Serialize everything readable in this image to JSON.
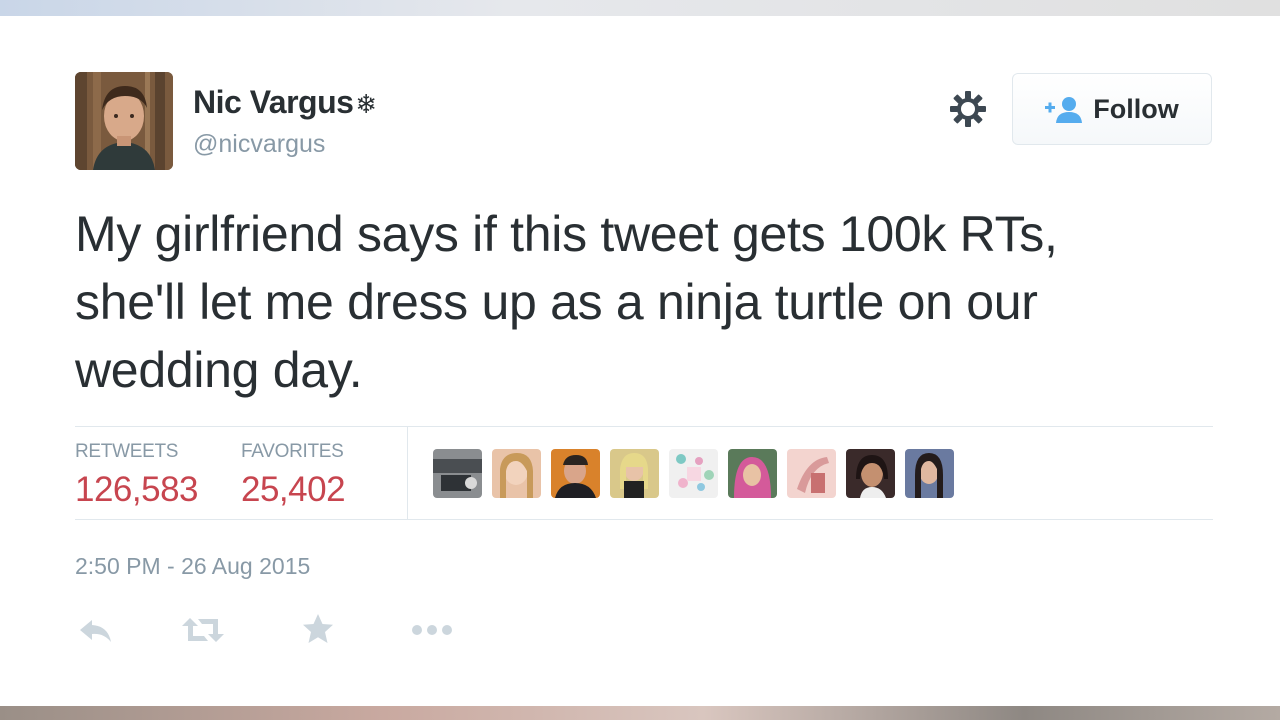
{
  "author": {
    "name": "Nic Vargus",
    "badge": "❄",
    "handle": "@nicvargus",
    "avatar_icon": "profile-photo"
  },
  "header": {
    "settings_icon": "gear-icon",
    "follow_icon": "add-user-icon",
    "follow_label": "Follow"
  },
  "tweet": {
    "lines": [
      "My girlfriend says if this tweet gets 100k RTs,",
      "she'll let me dress up as a ninja turtle on our",
      "wedding day."
    ]
  },
  "stats": {
    "retweets_label": "RETWEETS",
    "retweets_value": "126,583",
    "favorites_label": "FAVORITES",
    "favorites_value": "25,402"
  },
  "timestamp": "2:50 PM - 26 Aug 2015",
  "actions": [
    "reply-icon",
    "retweet-icon",
    "favorite-icon",
    "more-icon"
  ],
  "colors": {
    "text": "#292f33",
    "muted": "#8899a6",
    "stat_value": "#c7454f",
    "follow_icon": "#55acee",
    "action_icon": "#ccd6dd"
  },
  "favoriter_count_shown": 9
}
